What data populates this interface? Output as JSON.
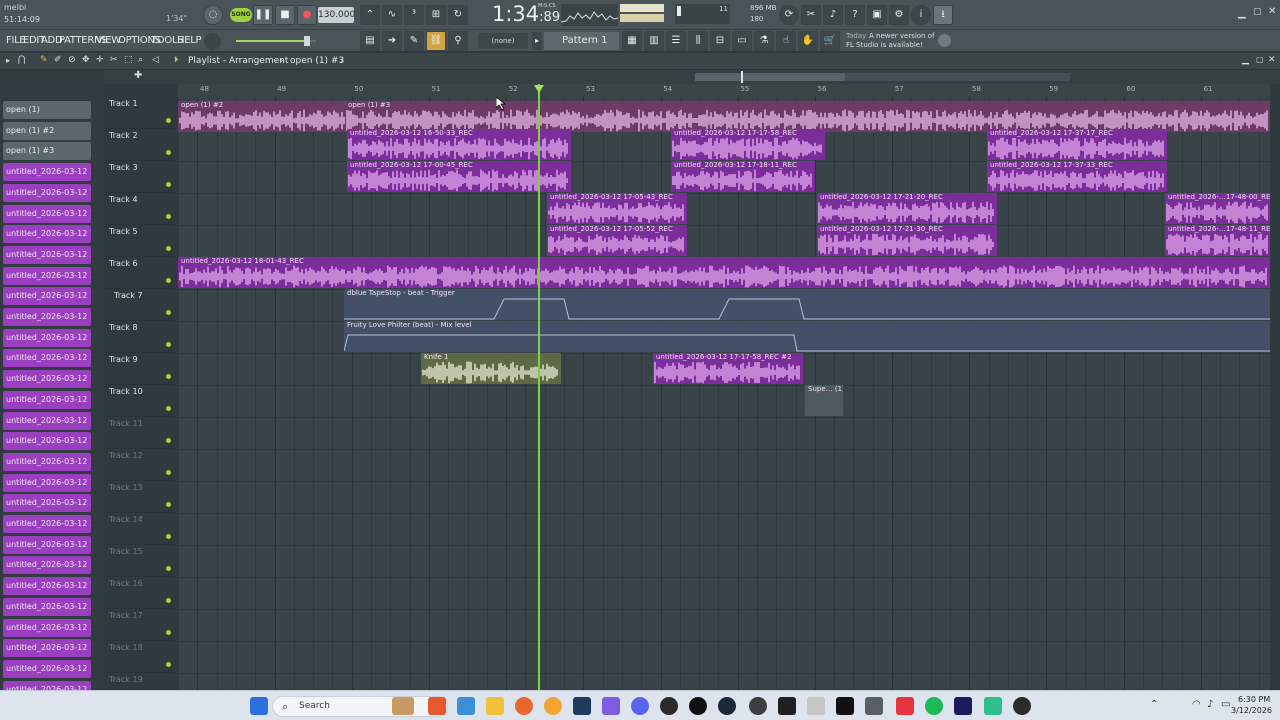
{
  "topbar": {
    "user": "melbi",
    "time": "51:14:09",
    "hint": "1'34\"",
    "mode_song": "SONG",
    "tempo": "130.000",
    "position_main": "1:34",
    "position_sub": ":89",
    "position_unit": "M:S:CS",
    "cpu_a": "11",
    "mem": "896 MB",
    "mem_b": "180",
    "pattern": "Pattern 1",
    "snap": "(none)",
    "update_day": "Today",
    "update_msg": "A newer version of",
    "update_msg2": "FL Studio is available!"
  },
  "menu": [
    "FILE",
    "EDIT",
    "ADD",
    "PATTERNS",
    "VIEW",
    "OPTIONS",
    "TOOLS",
    "HELP"
  ],
  "playlist": {
    "title": "Playlist - Arrangement",
    "breadcrumb_sep": "›",
    "current": "open (1) #3"
  },
  "ruler": [
    "48",
    "49",
    "50",
    "51",
    "52",
    "53",
    "54",
    "55",
    "56",
    "57",
    "58",
    "59",
    "60",
    "61"
  ],
  "picker": [
    "open (1)",
    "open (1) #2",
    "open (1) #3",
    "untitled_2026-03-12 16-…",
    "untitled_2026-03-12 16-…",
    "untitled_2026-03-12 16-…",
    "untitled_2026-03-12 16-…",
    "untitled_2026-03-12 16-…",
    "untitled_2026-03-12 16-…",
    "untitled_2026-03-12 16-…",
    "untitled_2026-03-12 17-…",
    "untitled_2026-03-12 17-…",
    "untitled_2026-03-12 17-…",
    "untitled_2026-03-12 17-…",
    "untitled_2026-03-12 17-…",
    "untitled_2026-03-12 17-…",
    "untitled_2026-03-12 17-…",
    "untitled_2026-03-12 17-…",
    "untitled_2026-03-12 17-…",
    "untitled_2026-03-12 17-…",
    "untitled_2026-03-12 17-…",
    "untitled_2026-03-12 17-…",
    "untitled_2026-03-12 17-…",
    "untitled_2026-03-12 17-…",
    "untitled_2026-03-12 17-…",
    "untitled_2026-03-12 17-…",
    "untitled_2026-03-12 17-…",
    "untitled_2026-03-12 17-…",
    "untitled_2026-03-12 17-…"
  ],
  "tracks": [
    "Track 1",
    "Track 2",
    "Track 3",
    "Track 4",
    "Track 5",
    "Track 6",
    "Track 7",
    "Track 8",
    "Track 9",
    "Track 10",
    "Track 11",
    "Track 12",
    "Track 13",
    "Track 14",
    "Track 15",
    "Track 16",
    "Track 17",
    "Track 18",
    "Track 19"
  ],
  "clips": {
    "t1a": "open (1) #2",
    "t1b": "open (1) #3",
    "t2a": "untitled_2026-03-12 16-50-33_REC",
    "t2b": "untitled_2026-03-12 17-17-58_REC",
    "t2c": "untitled_2026-03-12 17-37-17_REC",
    "t3a": "untitled_2026-03-12 17-00-45_REC",
    "t3b": "untitled_2026-03-12 17-18-11_REC",
    "t3c": "untitled_2026-03-12 17-37-33_REC",
    "t4a": "untitled_2026-03-12 17-05-43_REC",
    "t4b": "untitled_2026-03-12 17-21-20_REC",
    "t4c": "untitled_2026-…17-48-00_REC",
    "t5a": "untitled_2026-03-12 17-05-52_REC",
    "t5b": "untitled_2026-03-12 17-21-30_REC",
    "t5c": "untitled_2026-…17-48-11_REC",
    "t6a": "untitled_2026-03-12 18-01-43_REC",
    "t7a": "dblue TapeStop - beat - Trigger",
    "t8a": "Fruity Love Philter (beat) - Mix level",
    "t9a": "Knife 1",
    "t9b": "untitled_2026-03-12 17-17-58_REC #2",
    "t10a": "Supe… (1)"
  },
  "taskbar": {
    "search": "Search",
    "clock_time": "6:30 PM",
    "clock_date": "3/12/2026"
  },
  "colors": {
    "audio_clip": "#7b2d99",
    "open_clip": "#6e3a66",
    "playhead": "#7dd33f",
    "grid": "#394448"
  }
}
